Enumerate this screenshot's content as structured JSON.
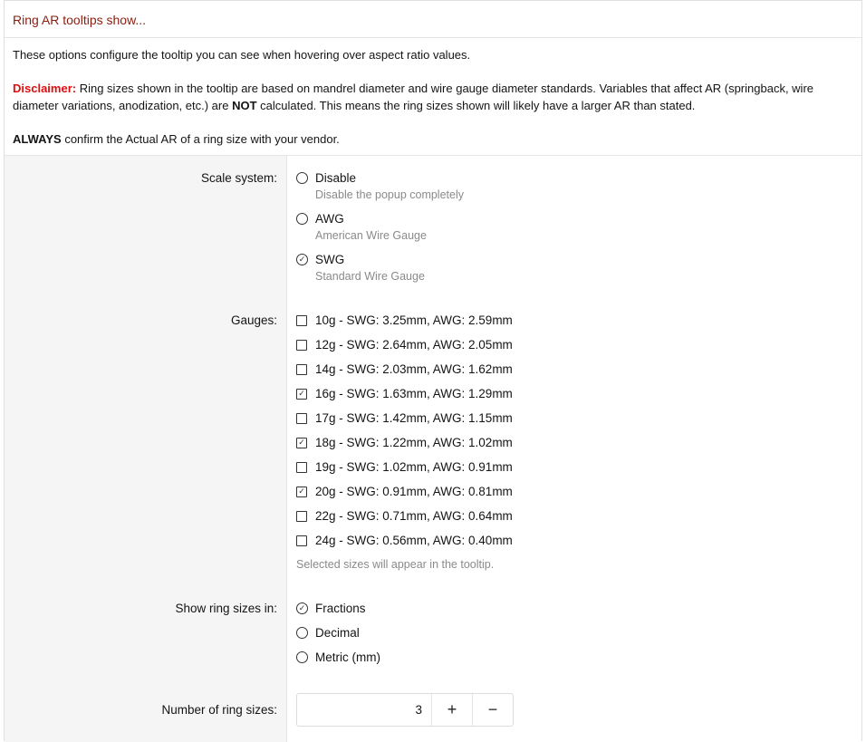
{
  "header": {
    "title": "Ring AR tooltips show..."
  },
  "intro": {
    "description": "These options configure the tooltip you can see when hovering over aspect ratio values.",
    "disclaimer_label": "Disclaimer:",
    "disclaimer_text_a": " Ring sizes shown in the tooltip are based on mandrel diameter and wire gauge diameter standards. Variables that affect AR (springback, wire diameter variations, anodization, etc.) are ",
    "disclaimer_not": "NOT",
    "disclaimer_text_b": " calculated. This means the ring sizes shown will likely have a larger AR than stated.",
    "always_label": "ALWAYS",
    "always_text": " confirm the Actual AR of a ring size with your vendor."
  },
  "scale_system": {
    "label": "Scale system:",
    "options": [
      {
        "label": "Disable",
        "hint": "Disable the popup completely",
        "selected": false
      },
      {
        "label": "AWG",
        "hint": "American Wire Gauge",
        "selected": false
      },
      {
        "label": "SWG",
        "hint": "Standard Wire Gauge",
        "selected": true
      }
    ]
  },
  "gauges": {
    "label": "Gauges:",
    "options": [
      {
        "label": "10g - SWG: 3.25mm, AWG: 2.59mm",
        "checked": false
      },
      {
        "label": "12g - SWG: 2.64mm, AWG: 2.05mm",
        "checked": false
      },
      {
        "label": "14g - SWG: 2.03mm, AWG: 1.62mm",
        "checked": false
      },
      {
        "label": "16g - SWG: 1.63mm, AWG: 1.29mm",
        "checked": true
      },
      {
        "label": "17g - SWG: 1.42mm, AWG: 1.15mm",
        "checked": false
      },
      {
        "label": "18g - SWG: 1.22mm, AWG: 1.02mm",
        "checked": true
      },
      {
        "label": "19g - SWG: 1.02mm, AWG: 0.91mm",
        "checked": false
      },
      {
        "label": "20g - SWG: 0.91mm, AWG: 0.81mm",
        "checked": true
      },
      {
        "label": "22g - SWG: 0.71mm, AWG: 0.64mm",
        "checked": false
      },
      {
        "label": "24g - SWG: 0.56mm, AWG: 0.40mm",
        "checked": false
      }
    ],
    "note": "Selected sizes will appear in the tooltip."
  },
  "ring_sizes_format": {
    "label": "Show ring sizes in:",
    "options": [
      {
        "label": "Fractions",
        "selected": true
      },
      {
        "label": "Decimal",
        "selected": false
      },
      {
        "label": "Metric (mm)",
        "selected": false
      }
    ]
  },
  "ring_size_count": {
    "label": "Number of ring sizes:",
    "value": "3",
    "increment": "+",
    "decrement": "−"
  }
}
